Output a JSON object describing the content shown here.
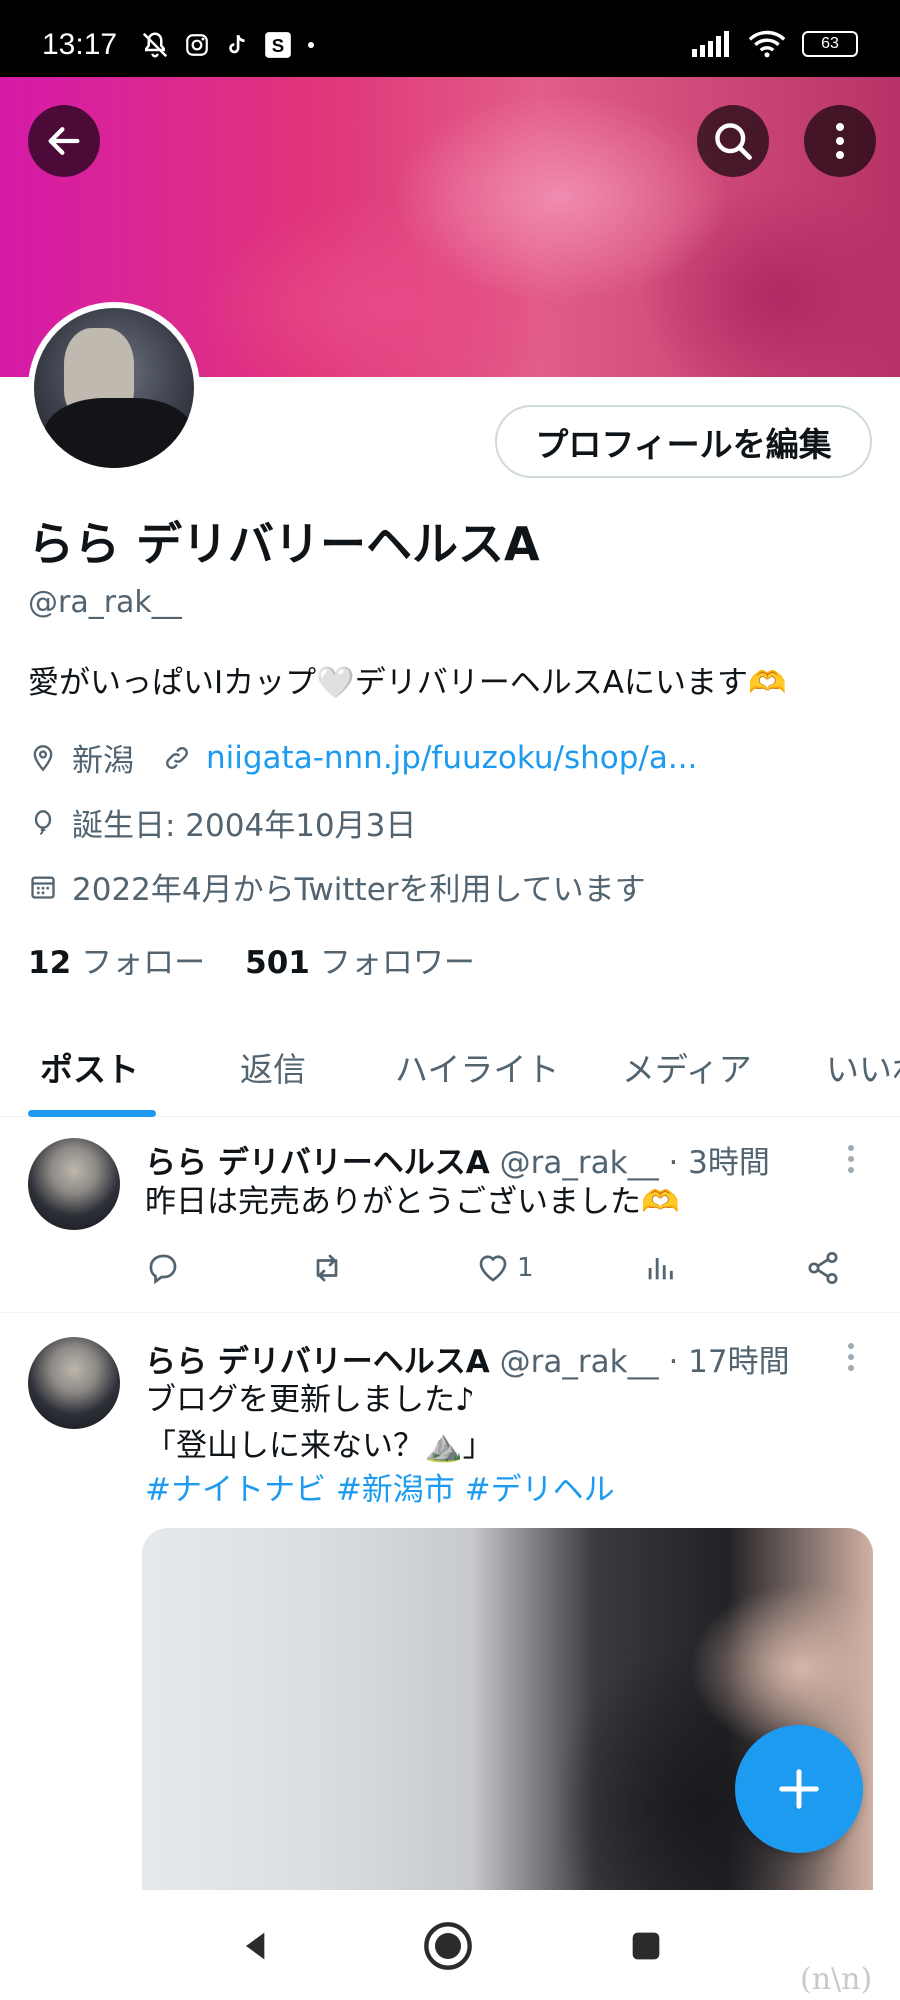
{
  "status_bar": {
    "time": "13:17",
    "battery": "63",
    "left_icons": [
      "muted-bell-icon",
      "instagram-icon",
      "tiktok-icon",
      "s-app-icon",
      "dot-icon"
    ],
    "right_icons": [
      "signal-icon",
      "wifi-icon",
      "battery-icon"
    ]
  },
  "header": {
    "back_icon": "arrow-left-icon",
    "search_icon": "search-icon",
    "more_icon": "more-vertical-icon"
  },
  "profile": {
    "edit_button": "プロフィールを編集",
    "display_name": "らら デリバリーヘルスA",
    "handle": "@ra_rak__",
    "bio": "愛がいっぱいIカップ🤍デリバリーヘルスAにいます🫶",
    "location": "新潟",
    "website": "niigata-nnn.jp/fuuzoku/shop/a...",
    "birthday": "誕生日: 2004年10月3日",
    "joined": "2022年4月からTwitterを利用しています",
    "following_count": "12",
    "following_label": "フォロー",
    "followers_count": "501",
    "followers_label": "フォロワー"
  },
  "tabs": [
    {
      "label": "ポスト",
      "active": true
    },
    {
      "label": "返信",
      "active": false
    },
    {
      "label": "ハイライト",
      "active": false
    },
    {
      "label": "メディア",
      "active": false
    },
    {
      "label": "いいね",
      "active": false
    }
  ],
  "tweets": [
    {
      "name": "らら デリバリーヘルスA",
      "handle": "@ra_rak__",
      "time": "· 3時間",
      "text_lines": [
        "昨日は完売ありがとうございました🫶"
      ],
      "likes": "1"
    },
    {
      "name": "らら デリバリーヘルスA",
      "handle": "@ra_rak__",
      "time": "· 17時間",
      "text_lines": [
        "ブログを更新しました♪",
        "「登山しに来ない？⛰️」"
      ],
      "hashtags": "#ナイトナビ #新潟市 #デリヘル"
    }
  ],
  "fab": {
    "icon": "plus-icon"
  },
  "nav": {
    "back": "nav-back-icon",
    "home": "nav-home-icon",
    "recents": "nav-recents-icon"
  },
  "watermark": "(n\\n)",
  "colors": {
    "accent": "#1d9bf0",
    "text": "#0f1419",
    "secondary": "#536471",
    "border": "#cfd9de"
  }
}
